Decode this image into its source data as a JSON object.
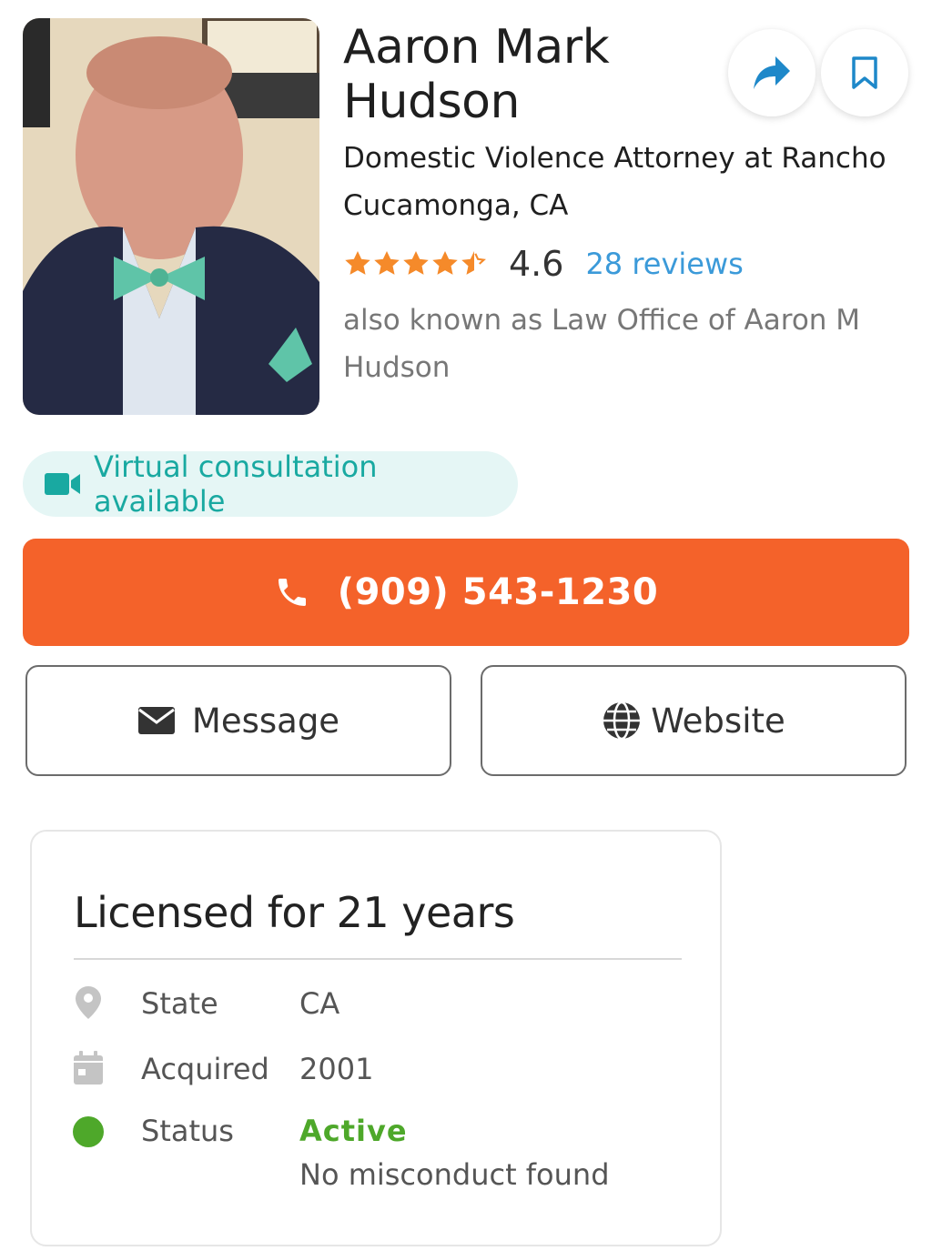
{
  "profile": {
    "name": "Aaron Mark Hudson",
    "subtitle": "Domestic Violence Attorney at Rancho Cucamonga, CA",
    "rating": "4.6",
    "rating_value": 4.6,
    "reviews_label": "28 reviews",
    "aka": "also known as Law Office of Aaron M Hudson",
    "photo_icon": "attorney-portrait"
  },
  "actions": {
    "share_icon": "share-arrow-icon",
    "bookmark_icon": "bookmark-icon"
  },
  "virtual": {
    "label": "Virtual consultation available",
    "icon": "video-camera-icon"
  },
  "contact": {
    "phone": "(909) 543-1230",
    "message_label": "Message",
    "website_label": "Website"
  },
  "license": {
    "title": "Licensed for 21 years",
    "state_label": "State",
    "state_value": "CA",
    "acquired_label": "Acquired",
    "acquired_value": "2001",
    "status_label": "Status",
    "status_value": "Active",
    "status_note": "No misconduct found"
  },
  "colors": {
    "accent_orange": "#f4622a",
    "star_orange": "#f58a2a",
    "link_blue": "#3b9ad9",
    "teal": "#19a9a1",
    "active_green": "#4ea82a"
  }
}
